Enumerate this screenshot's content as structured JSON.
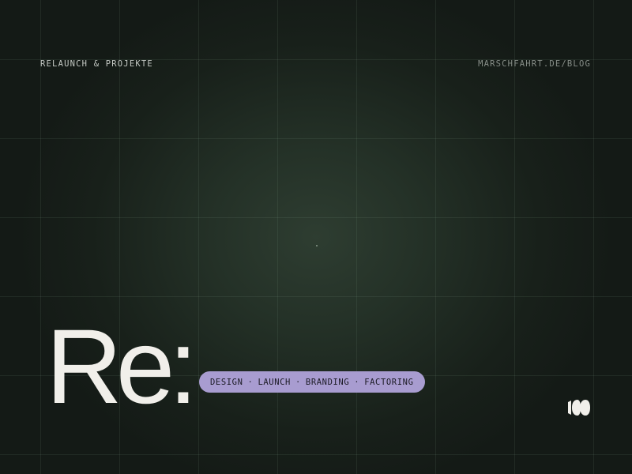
{
  "header": {
    "left_label": "RELAUNCH & PROJEKTE",
    "right_label": "MARSCHFAHRT.DE/BLOG"
  },
  "hero": {
    "title": "Re:"
  },
  "tags": {
    "items": [
      "DESIGN",
      "LAUNCH",
      "BRANDING",
      "FACTORING"
    ],
    "separator": "·"
  },
  "colors": {
    "background": "#141a16",
    "glow": "#2e3d31",
    "title": "#f1efea",
    "pill": "#a89cd0",
    "pill_text": "#1b1a24"
  },
  "icons": {
    "brand_logo": "infinity-loop-logo"
  }
}
